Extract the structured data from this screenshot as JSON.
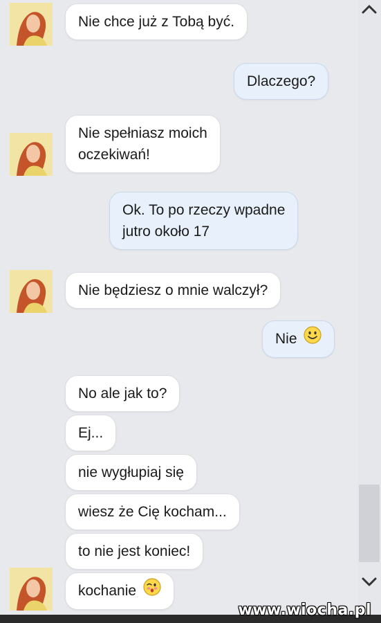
{
  "messages": [
    {
      "side": "in",
      "text": "Nie chce już z Tobą być."
    },
    {
      "side": "out",
      "text": "Dlaczego?"
    },
    {
      "side": "in",
      "line1": "Nie spełniasz moich",
      "line2": "oczekiwań!"
    },
    {
      "side": "out",
      "line1": "Ok. To po rzeczy wpadne",
      "line2": "jutro około 17"
    },
    {
      "side": "in",
      "text": "Nie będziesz o mnie walczył?"
    },
    {
      "side": "out",
      "text": "Nie",
      "emoji": "smiley-icon"
    },
    {
      "side": "in",
      "text": "No ale jak to?"
    },
    {
      "side": "in",
      "text": "Ej..."
    },
    {
      "side": "in",
      "text": "nie wygłupiaj się"
    },
    {
      "side": "in",
      "text": "wiesz że Cię kocham..."
    },
    {
      "side": "in",
      "text": "to nie jest koniec!"
    },
    {
      "side": "in",
      "text": "kochanie",
      "emoji": "kiss-smiley-icon"
    }
  ],
  "watermark": "www.wiocha.pl",
  "colors": {
    "background": "#e8e9ed",
    "incoming_bubble": "#ffffff",
    "outgoing_bubble": "#e8f1fb"
  }
}
